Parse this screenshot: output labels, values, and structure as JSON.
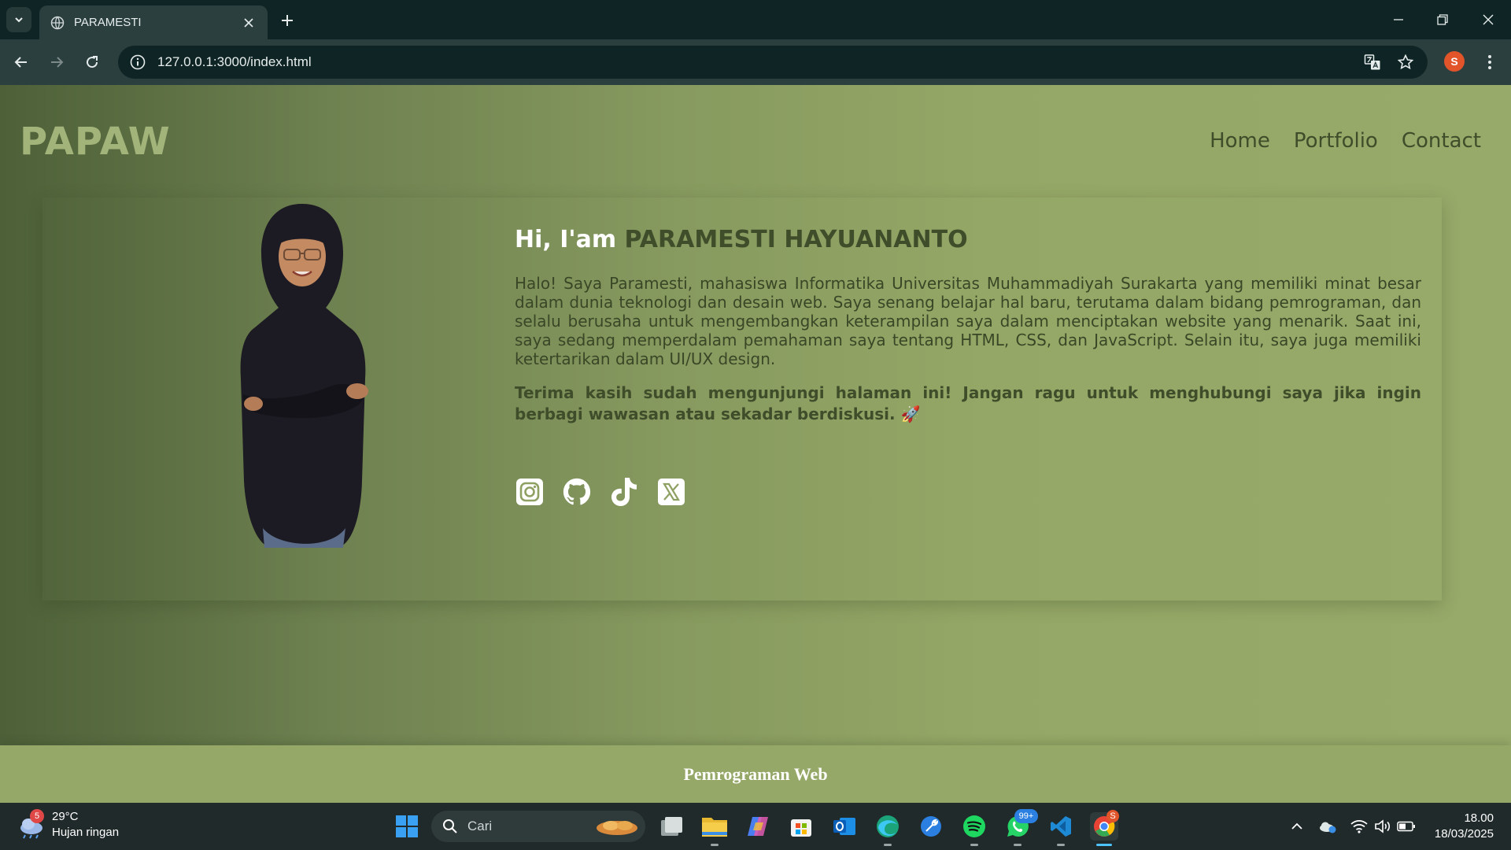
{
  "browser": {
    "tab_title": "PARAMESTI",
    "url": "127.0.0.1:3000/index.html",
    "profile_initial": "S"
  },
  "site": {
    "logo": "PAPAW",
    "nav": [
      "Home",
      "Portfolio",
      "Contact"
    ],
    "intro": {
      "greeting": "Hi, I'am",
      "name": "PARAMESTI HAYUANANTO",
      "bio": "Halo! Saya Paramesti, mahasiswa Informatika Universitas Muhammadiyah Surakarta yang memiliki minat besar dalam dunia teknologi dan desain web. Saya senang belajar hal baru, terutama dalam bidang pemrograman, dan selalu berusaha untuk mengembangkan keterampilan saya dalam menciptakan website yang menarik. Saat ini, saya sedang memperdalam pemahaman saya tentang HTML, CSS, dan JavaScript. Selain itu, saya juga memiliki ketertarikan dalam UI/UX design.",
      "thanks": "Terima kasih sudah mengunjungi halaman ini! Jangan ragu untuk menghubungi saya jika ingin berbagi wawasan atau sekadar berdiskusi. 🚀"
    },
    "socials": [
      "instagram-icon",
      "github-icon",
      "tiktok-icon",
      "x-icon"
    ],
    "footer": "Pemrograman Web",
    "colors": {
      "accent": "#3f4d2a",
      "logo": "#a3b47a",
      "footer": "#96a868"
    }
  },
  "taskbar": {
    "weather_temp": "29°C",
    "weather_desc": "Hujan ringan",
    "weather_badge": "5",
    "search_placeholder": "Cari",
    "whatsapp_badge": "99+",
    "chrome_badge": "S",
    "time": "18.00",
    "date": "18/03/2025"
  }
}
